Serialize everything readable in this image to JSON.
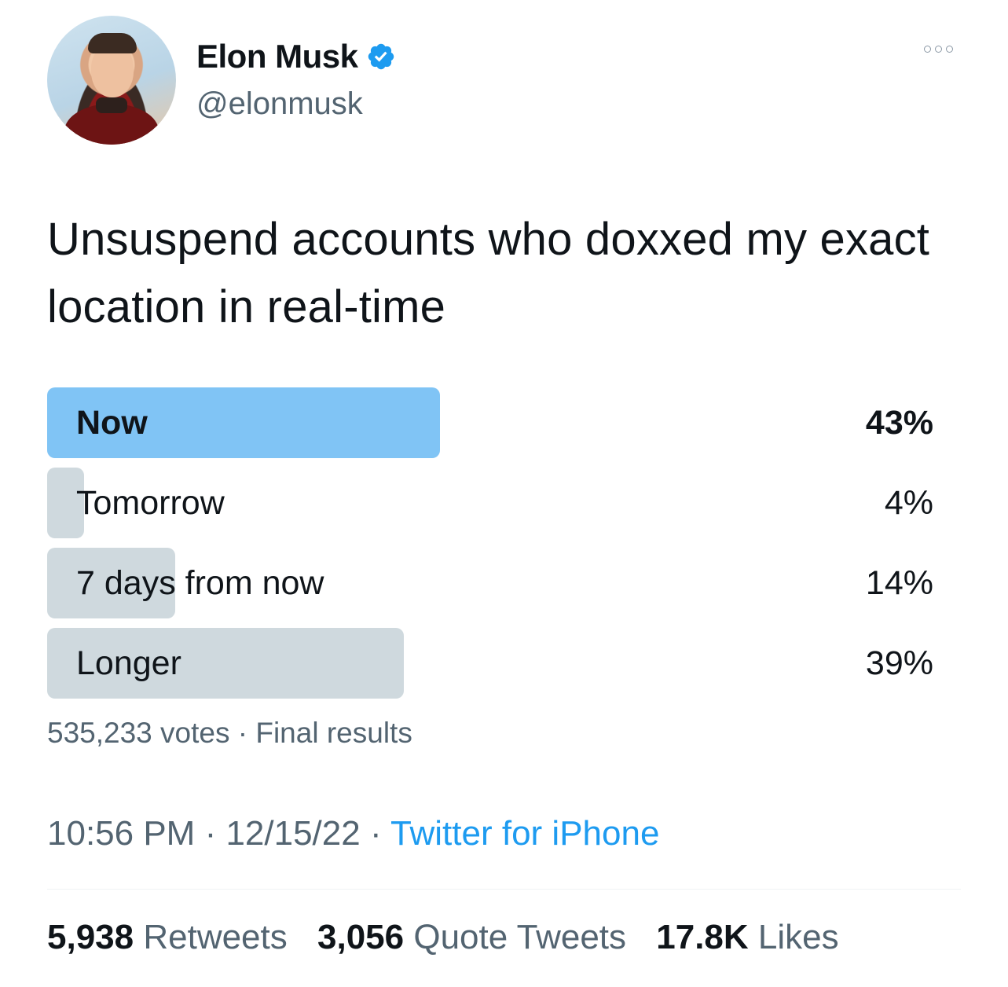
{
  "author": {
    "display_name": "Elon Musk",
    "handle": "@elonmusk",
    "verified": true,
    "verified_color": "#1d9bf0"
  },
  "tweet": {
    "text": "Unsuspend accounts who doxxed my exact location in real-time"
  },
  "poll": {
    "options": [
      {
        "label": "Now",
        "percent_label": "43%",
        "percent": 43,
        "winner": true
      },
      {
        "label": "Tomorrow",
        "percent_label": "4%",
        "percent": 4,
        "winner": false
      },
      {
        "label": "7 days from now",
        "percent_label": "14%",
        "percent": 14,
        "winner": false
      },
      {
        "label": "Longer",
        "percent_label": "39%",
        "percent": 39,
        "winner": false
      }
    ],
    "votes": "535,233 votes",
    "separator": " · ",
    "status": "Final results",
    "winner_color": "#80c4f5",
    "bar_color": "#cfd9de"
  },
  "meta": {
    "time": "10:56 PM",
    "date": "12/15/22",
    "separator": " · ",
    "source": "Twitter for iPhone",
    "source_color": "#1d9bf0"
  },
  "stats": {
    "retweets_count": "5,938",
    "retweets_label": "Retweets",
    "quotes_count": "3,056",
    "quotes_label": "Quote Tweets",
    "likes_count": "17.8K",
    "likes_label": "Likes"
  }
}
